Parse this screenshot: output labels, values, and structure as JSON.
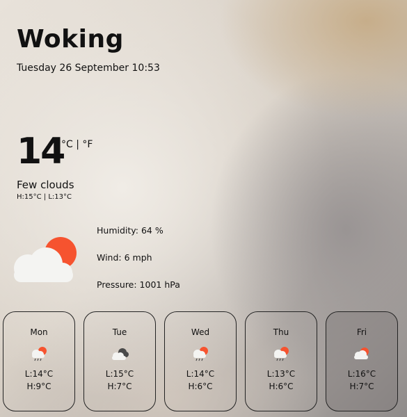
{
  "location": {
    "city": "Woking",
    "datetime": "Tuesday 26 September 10:53"
  },
  "current": {
    "temperature": "14",
    "units_toggle": "°C | °F",
    "description": "Few clouds",
    "high_low": "H:15°C | L:13°C",
    "icon": "few-clouds-day-icon",
    "humidity": "Humidity: 64 %",
    "wind": "Wind: 6 mph",
    "pressure": "Pressure: 1001 hPa"
  },
  "forecast": [
    {
      "day": "Mon",
      "icon": "light-rain-icon",
      "low": "L:14°C",
      "high": "H:9°C"
    },
    {
      "day": "Tue",
      "icon": "overcast-clouds-icon",
      "low": "L:15°C",
      "high": "H:7°C"
    },
    {
      "day": "Wed",
      "icon": "light-rain-icon",
      "low": "L:14°C",
      "high": "H:6°C"
    },
    {
      "day": "Thu",
      "icon": "light-rain-icon",
      "low": "L:13°C",
      "high": "H:6°C"
    },
    {
      "day": "Fri",
      "icon": "few-clouds-day-icon",
      "low": "L:16°C",
      "high": "H:7°C"
    }
  ],
  "colors": {
    "sun": "#f6532f",
    "cloud": "#f4f4f2",
    "dark_cloud": "#4a4a4a",
    "text": "#111111"
  }
}
